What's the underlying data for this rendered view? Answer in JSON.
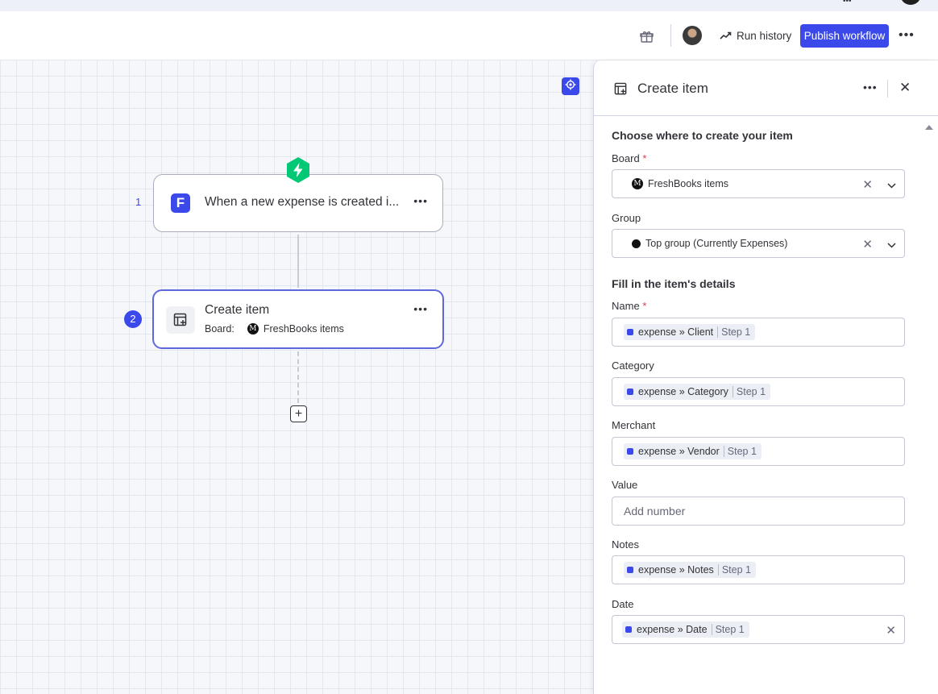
{
  "header": {
    "run_history_label": "Run history",
    "publish_label": "Publish workflow"
  },
  "workflow": {
    "step1": {
      "number": "1",
      "title": "When a new expense is created i...",
      "logo": "F"
    },
    "step2": {
      "number": "2",
      "title": "Create item",
      "board_label": "Board:",
      "board_badge": "M",
      "board_name": "FreshBooks items"
    },
    "add_step_glyph": "+"
  },
  "panel": {
    "title": "Create item",
    "section1_title": "Choose where to create your item",
    "board": {
      "label": "Board",
      "required": "*",
      "badge": "M",
      "value": "FreshBooks items"
    },
    "group": {
      "label": "Group",
      "value": "Top group (Currently Expenses)"
    },
    "section2_title": "Fill in the item's details",
    "fields": {
      "name": {
        "label": "Name",
        "required": "*",
        "chip": "expense » Client",
        "step": "Step 1"
      },
      "category": {
        "label": "Category",
        "chip": "expense » Category",
        "step": "Step 1"
      },
      "merchant": {
        "label": "Merchant",
        "chip": "expense » Vendor",
        "step": "Step 1"
      },
      "value": {
        "label": "Value",
        "placeholder": "Add number"
      },
      "notes": {
        "label": "Notes",
        "chip": "expense » Notes",
        "step": "Step 1"
      },
      "date": {
        "label": "Date",
        "chip": "expense » Date",
        "step": "Step 1"
      }
    }
  },
  "colors": {
    "accent": "#3b49ea",
    "trigger": "#00c875",
    "required": "#d83a52"
  },
  "icons": {
    "gift": "gift-icon",
    "trend": "trend-up-icon",
    "more": "more-horizontal-icon",
    "close": "close-icon",
    "chevron": "chevron-down-icon",
    "recenter": "recenter-icon",
    "bolt": "lightning-bolt-icon",
    "create_item": "create-item-icon"
  }
}
